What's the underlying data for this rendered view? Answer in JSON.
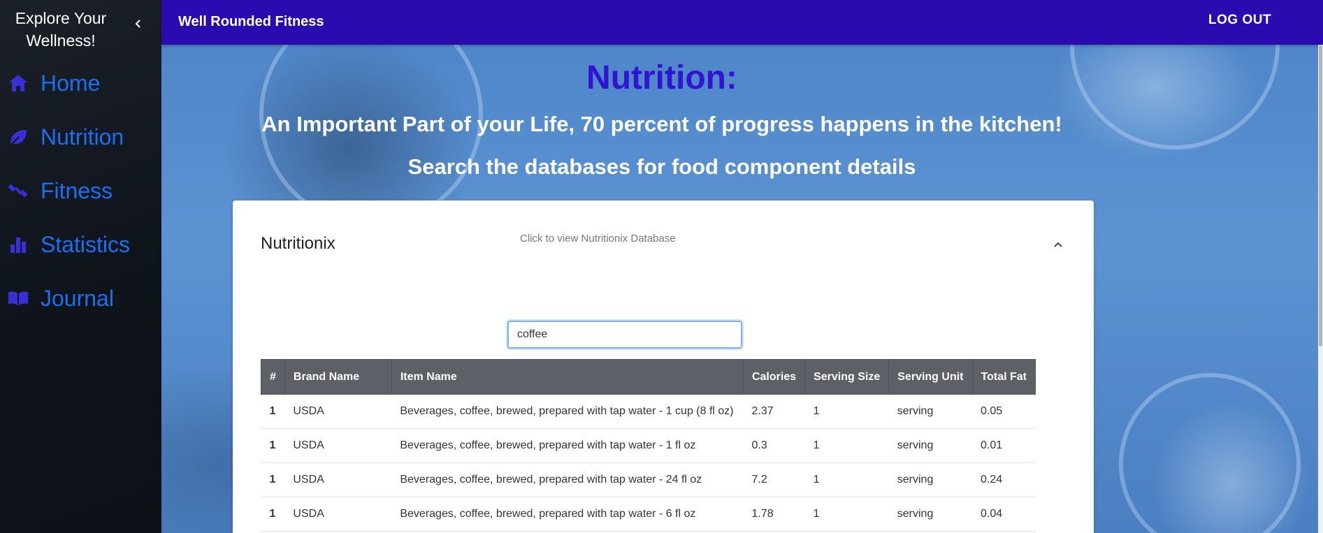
{
  "sidebar": {
    "title": "Explore Your Wellness!",
    "items": [
      {
        "label": "Home",
        "icon": "home-icon"
      },
      {
        "label": "Nutrition",
        "icon": "leaf-icon"
      },
      {
        "label": "Fitness",
        "icon": "dumbbell-icon"
      },
      {
        "label": "Statistics",
        "icon": "bar-chart-icon"
      },
      {
        "label": "Journal",
        "icon": "book-icon"
      }
    ]
  },
  "header": {
    "app_title": "Well Rounded Fitness",
    "logout_label": "LOG OUT"
  },
  "main": {
    "heading": "Nutrition:",
    "subheading_1": "An Important Part of your Life, 70 percent of progress happens in the kitchen!",
    "subheading_2": "Search the databases for food component details"
  },
  "panel": {
    "title": "Nutritionix",
    "subtitle": "Click to view Nutritionix Database",
    "search_value": "coffee",
    "columns": [
      "#",
      "Brand Name",
      "Item Name",
      "Calories",
      "Serving Size",
      "Serving Unit",
      "Total Fat"
    ],
    "rows": [
      [
        "1",
        "USDA",
        "Beverages, coffee, brewed, prepared with tap water - 1 cup (8 fl oz)",
        "2.37",
        "1",
        "serving",
        "0.05"
      ],
      [
        "1",
        "USDA",
        "Beverages, coffee, brewed, prepared with tap water - 1 fl oz",
        "0.3",
        "1",
        "serving",
        "0.01"
      ],
      [
        "1",
        "USDA",
        "Beverages, coffee, brewed, prepared with tap water - 24 fl oz",
        "7.2",
        "1",
        "serving",
        "0.24"
      ],
      [
        "1",
        "USDA",
        "Beverages, coffee, brewed, prepared with tap water - 6 fl oz",
        "1.78",
        "1",
        "serving",
        "0.04"
      ]
    ]
  },
  "colors": {
    "topbar": "#2a0bb0",
    "nav_text": "#1e6ff0",
    "nav_icon": "#3a2fd6",
    "heading": "#3014d2",
    "table_header": "#5d6167"
  }
}
